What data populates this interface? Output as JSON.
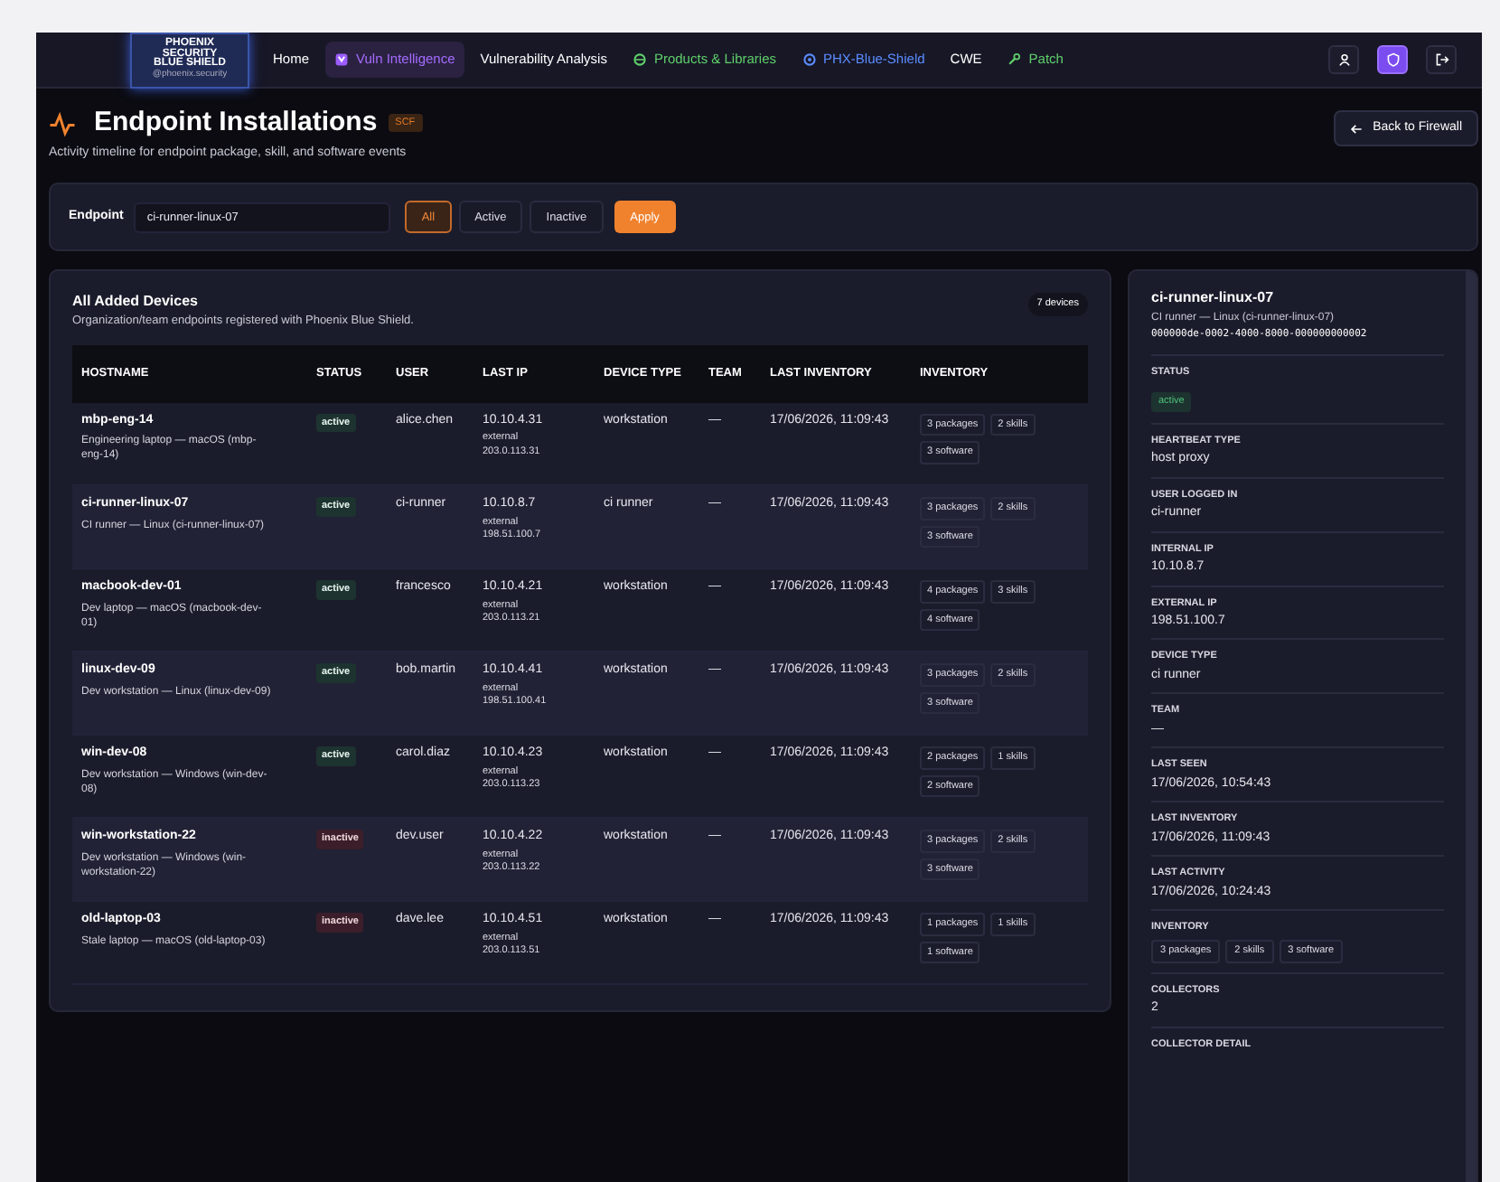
{
  "logo": {
    "lines": [
      "PHOENIX",
      "SECURITY",
      "BLUE SHIELD"
    ],
    "handle": "@phoenix.security"
  },
  "nav": [
    {
      "label": "Home",
      "selected": false,
      "color": "#ffffff"
    },
    {
      "label": "Vuln Intelligence",
      "selected": true,
      "color": "#a66bff"
    },
    {
      "label": "Vulnerability Analysis",
      "selected": false,
      "color": "#ffffff"
    },
    {
      "label": "Products & Libraries",
      "selected": false,
      "color": "#5fcf6a"
    },
    {
      "label": "PHX-Blue-Shield",
      "selected": false,
      "color": "#5b8cff"
    },
    {
      "label": "CWE",
      "selected": false,
      "color": "#ffffff"
    },
    {
      "label": "Patch",
      "selected": false,
      "color": "#5fcf6a"
    }
  ],
  "nav_actions": [
    {
      "selected": false
    },
    {
      "selected": true
    },
    {
      "selected": false
    }
  ],
  "header": {
    "title": "Endpoint Installations",
    "tag": "SCF",
    "subtitle": "Activity timeline for endpoint package, skill, and software events",
    "back": "Back to Firewall"
  },
  "filter": {
    "label": "Endpoint",
    "value": "ci-runner-linux-07",
    "segments": [
      {
        "label": "All",
        "selected": true
      },
      {
        "label": "Active",
        "selected": false
      },
      {
        "label": "Inactive",
        "selected": false
      }
    ],
    "apply": "Apply"
  },
  "table": {
    "title": "All Added Devices",
    "subtitle": "Organization/team endpoints registered with Phoenix Blue Shield.",
    "count": "7 devices",
    "columns": [
      "HOSTNAME",
      "STATUS",
      "USER",
      "LAST IP",
      "DEVICE TYPE",
      "TEAM",
      "LAST INVENTORY",
      "INVENTORY"
    ],
    "rows": [
      {
        "hostname": "mbp-eng-14",
        "description": "Engineering laptop — macOS (mbp-eng-14)",
        "status": {
          "label": "active",
          "kind": "active"
        },
        "user": "alice.chen",
        "ip": "10.10.4.31",
        "ext_label": "external",
        "ext_ip": "203.0.113.31",
        "device_type": "workstation",
        "team": "—",
        "last_inventory": "17/06/2026, 11:09:43",
        "inventory": [
          "3 packages",
          "2 skills",
          "3 software"
        ]
      },
      {
        "hostname": "ci-runner-linux-07",
        "description": "CI runner — Linux (ci-runner-linux-07)",
        "status": {
          "label": "active",
          "kind": "active"
        },
        "user": "ci-runner",
        "ip": "10.10.8.7",
        "ext_label": "external",
        "ext_ip": "198.51.100.7",
        "device_type": "ci runner",
        "team": "—",
        "last_inventory": "17/06/2026, 11:09:43",
        "inventory": [
          "3 packages",
          "2 skills",
          "3 software"
        ]
      },
      {
        "hostname": "macbook-dev-01",
        "description": "Dev laptop — macOS (macbook-dev-01)",
        "status": {
          "label": "active",
          "kind": "active"
        },
        "user": "francesco",
        "ip": "10.10.4.21",
        "ext_label": "external",
        "ext_ip": "203.0.113.21",
        "device_type": "workstation",
        "team": "—",
        "last_inventory": "17/06/2026, 11:09:43",
        "inventory": [
          "4 packages",
          "3 skills",
          "4 software"
        ]
      },
      {
        "hostname": "linux-dev-09",
        "description": "Dev workstation — Linux (linux-dev-09)",
        "status": {
          "label": "active",
          "kind": "active"
        },
        "user": "bob.martin",
        "ip": "10.10.4.41",
        "ext_label": "external",
        "ext_ip": "198.51.100.41",
        "device_type": "workstation",
        "team": "—",
        "last_inventory": "17/06/2026, 11:09:43",
        "inventory": [
          "3 packages",
          "2 skills",
          "3 software"
        ]
      },
      {
        "hostname": "win-dev-08",
        "description": "Dev workstation — Windows (win-dev-08)",
        "status": {
          "label": "active",
          "kind": "active"
        },
        "user": "carol.diaz",
        "ip": "10.10.4.23",
        "ext_label": "external",
        "ext_ip": "203.0.113.23",
        "device_type": "workstation",
        "team": "—",
        "last_inventory": "17/06/2026, 11:09:43",
        "inventory": [
          "2 packages",
          "1 skills",
          "2 software"
        ]
      },
      {
        "hostname": "win-workstation-22",
        "description": "Dev workstation — Windows (win-workstation-22)",
        "status": {
          "label": "inactive",
          "kind": "inactive"
        },
        "user": "dev.user",
        "ip": "10.10.4.22",
        "ext_label": "external",
        "ext_ip": "203.0.113.22",
        "device_type": "workstation",
        "team": "—",
        "last_inventory": "17/06/2026, 11:09:43",
        "inventory": [
          "3 packages",
          "2 skills",
          "3 software"
        ]
      },
      {
        "hostname": "old-laptop-03",
        "description": "Stale laptop — macOS (old-laptop-03)",
        "status": {
          "label": "inactive",
          "kind": "inactive"
        },
        "user": "dave.lee",
        "ip": "10.10.4.51",
        "ext_label": "external",
        "ext_ip": "203.0.113.51",
        "device_type": "workstation",
        "team": "—",
        "last_inventory": "17/06/2026, 11:09:43",
        "inventory": [
          "1 packages",
          "1 skills",
          "1 software"
        ]
      }
    ]
  },
  "detail": {
    "title": "ci-runner-linux-07",
    "description": "CI runner — Linux (ci-runner-linux-07)",
    "id": "000000de-0002-4000-8000-000000000002",
    "fields": [
      {
        "label": "STATUS",
        "kind": "badge",
        "value": "active"
      },
      {
        "label": "HEARTBEAT TYPE",
        "kind": "text",
        "value": "host proxy"
      },
      {
        "label": "USER LOGGED IN",
        "kind": "text",
        "value": "ci-runner"
      },
      {
        "label": "INTERNAL IP",
        "kind": "text",
        "value": "10.10.8.7"
      },
      {
        "label": "EXTERNAL IP",
        "kind": "text",
        "value": "198.51.100.7"
      },
      {
        "label": "DEVICE TYPE",
        "kind": "text",
        "value": "ci runner"
      },
      {
        "label": "TEAM",
        "kind": "text",
        "value": "—"
      },
      {
        "label": "LAST SEEN",
        "kind": "text",
        "value": "17/06/2026, 10:54:43"
      },
      {
        "label": "LAST INVENTORY",
        "kind": "text",
        "value": "17/06/2026, 11:09:43"
      },
      {
        "label": "LAST ACTIVITY",
        "kind": "text",
        "value": "17/06/2026, 10:24:43"
      },
      {
        "label": "INVENTORY",
        "kind": "tags",
        "tags": [
          "3 packages",
          "2 skills",
          "3 software"
        ]
      },
      {
        "label": "COLLECTORS",
        "kind": "text",
        "value": "2"
      },
      {
        "label": "COLLECTOR DETAIL",
        "kind": "heading"
      }
    ]
  }
}
